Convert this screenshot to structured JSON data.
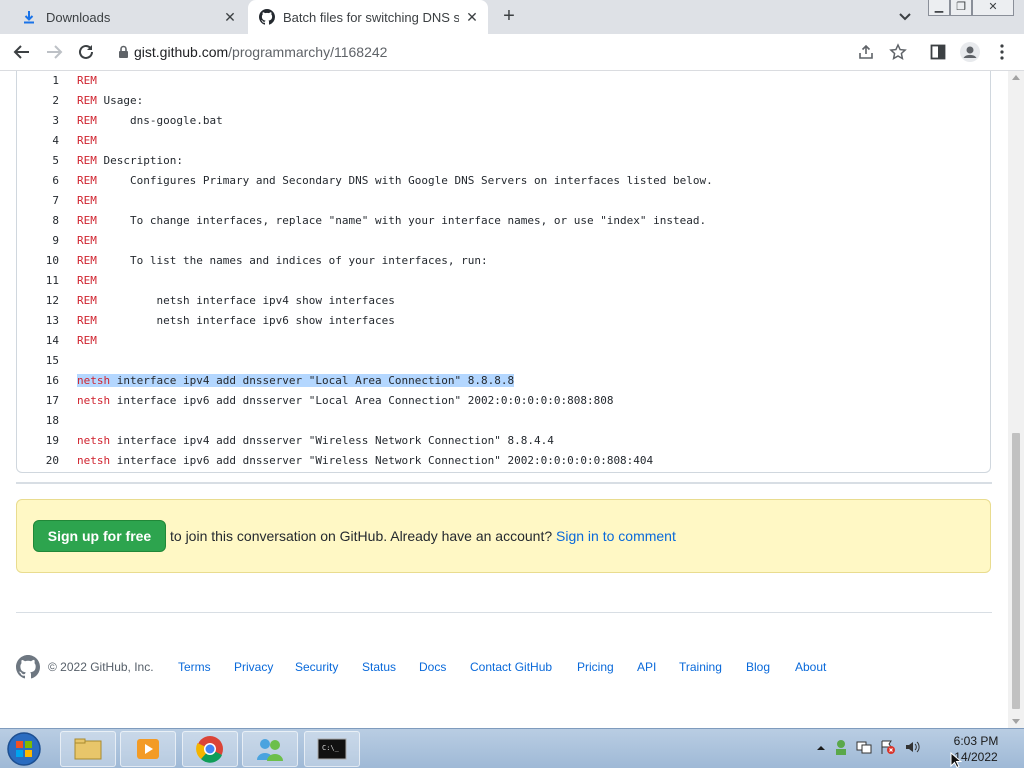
{
  "browser": {
    "tabs": [
      {
        "title": "Downloads",
        "icon": "download-icon",
        "active": false
      },
      {
        "title": "Batch files for switching DNS ser",
        "icon": "github-icon",
        "active": true
      }
    ],
    "url_host": "gist.github.com",
    "url_path": "/programmarchy/1168242"
  },
  "code": {
    "lines": [
      {
        "num": "1",
        "kw": "REM",
        "text": ""
      },
      {
        "num": "2",
        "kw": "REM",
        "text": " Usage:"
      },
      {
        "num": "3",
        "kw": "REM",
        "text": "     dns-google.bat"
      },
      {
        "num": "4",
        "kw": "REM",
        "text": ""
      },
      {
        "num": "5",
        "kw": "REM",
        "text": " Description:"
      },
      {
        "num": "6",
        "kw": "REM",
        "text": "     Configures Primary and Secondary DNS with Google DNS Servers on interfaces listed below."
      },
      {
        "num": "7",
        "kw": "REM",
        "text": ""
      },
      {
        "num": "8",
        "kw": "REM",
        "text": "     To change interfaces, replace \"name\" with your interface names, or use \"index\" instead."
      },
      {
        "num": "9",
        "kw": "REM",
        "text": ""
      },
      {
        "num": "10",
        "kw": "REM",
        "text": "     To list the names and indices of your interfaces, run:"
      },
      {
        "num": "11",
        "kw": "REM",
        "text": ""
      },
      {
        "num": "12",
        "kw": "REM",
        "text": "         netsh interface ipv4 show interfaces"
      },
      {
        "num": "13",
        "kw": "REM",
        "text": "         netsh interface ipv6 show interfaces"
      },
      {
        "num": "14",
        "kw": "REM",
        "text": ""
      },
      {
        "num": "15",
        "kw": "",
        "text": ""
      },
      {
        "num": "16",
        "kw": "netsh",
        "text": " interface ipv4 add dnsserver \"Local Area Connection\" 8.8.8.8",
        "highlighted": true
      },
      {
        "num": "17",
        "kw": "netsh",
        "text": " interface ipv6 add dnsserver \"Local Area Connection\" 2002:0:0:0:0:0:808:808"
      },
      {
        "num": "18",
        "kw": "",
        "text": ""
      },
      {
        "num": "19",
        "kw": "netsh",
        "text": " interface ipv4 add dnsserver \"Wireless Network Connection\" 8.8.4.4"
      },
      {
        "num": "20",
        "kw": "netsh",
        "text": " interface ipv6 add dnsserver \"Wireless Network Connection\" 2002:0:0:0:0:0:808:404"
      }
    ]
  },
  "signup": {
    "button": "Sign up for free",
    "text": " to join this conversation on GitHub. Already have an account? ",
    "link": "Sign in to comment"
  },
  "footer": {
    "copyright": "© 2022 GitHub, Inc.",
    "links": [
      "Terms",
      "Privacy",
      "Security",
      "Status",
      "Docs",
      "Contact GitHub",
      "Pricing",
      "API",
      "Training",
      "Blog",
      "About"
    ]
  },
  "taskbar": {
    "time": "6:03 PM",
    "date": "14/2022"
  },
  "colors": {
    "keyword": "#cf222e",
    "link": "#0969da",
    "signup_bg": "#fff8c5",
    "button_green": "#2da44e",
    "selection": "#b4d7ff"
  }
}
